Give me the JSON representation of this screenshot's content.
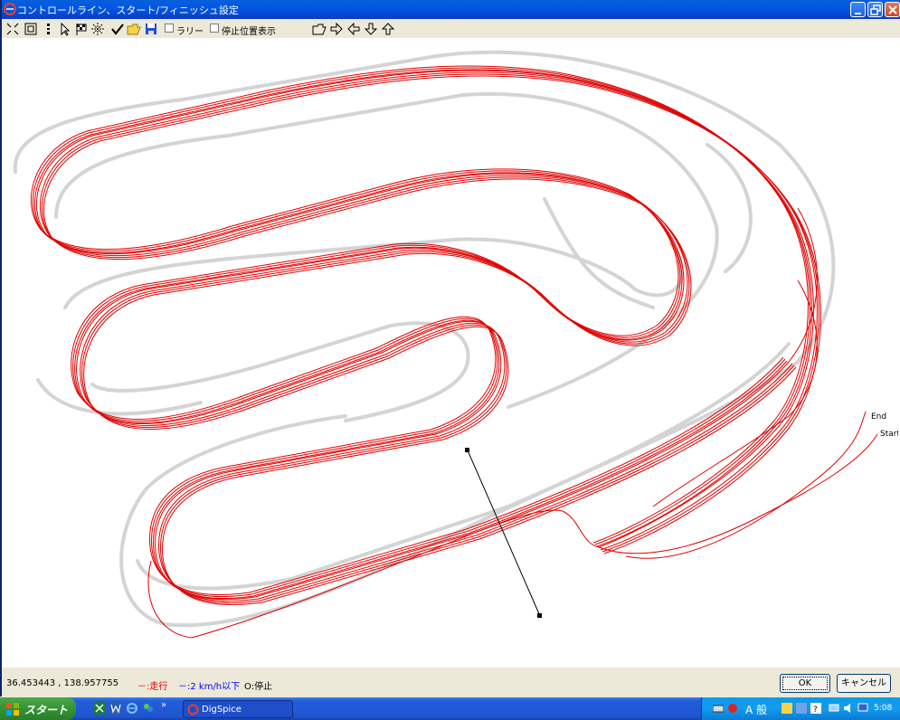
{
  "window": {
    "title": "コントロールライン、スタート/フィニッシュ設定"
  },
  "toolbar": {
    "icons": [
      "fit-icon",
      "zoom-icon",
      "marker-icon",
      "pointer-icon",
      "flag-icon",
      "sparkle-icon",
      "check-icon",
      "open-folder-icon",
      "save-icon"
    ],
    "rally_label": "ラリー",
    "stop_display_label": "停止位置表示",
    "nav_icons": [
      "open-icon",
      "arrow-right-icon",
      "arrow-left-icon",
      "arrow-down-icon",
      "arrow-up-icon"
    ]
  },
  "canvas": {
    "end_label": "End",
    "start_label": "Start",
    "track_color": "#d4d4d4",
    "line_color": "#e00000"
  },
  "status": {
    "coordinates": "36.453443 , 138.957755",
    "legend_run": "－:走行",
    "legend_slow": "－:2 km/h以下",
    "legend_stop": "O:停止",
    "run_color": "#e00000",
    "slow_color": "#0000ff"
  },
  "buttons": {
    "ok": "OK",
    "cancel": "キャンセル"
  },
  "taskbar": {
    "start_label": "スタート",
    "task_label": "DigSpice",
    "ime_label": "A 般",
    "time": "5:08"
  }
}
